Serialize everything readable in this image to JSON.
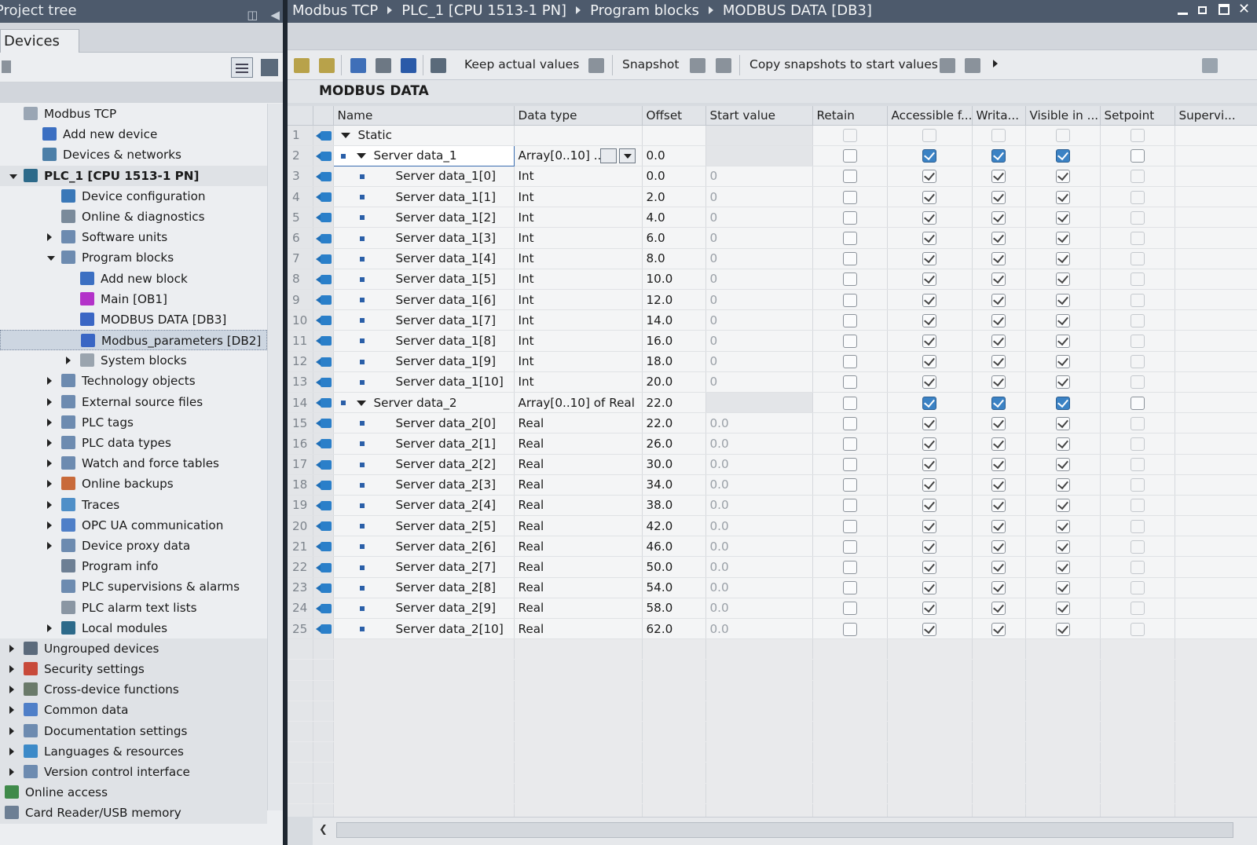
{
  "left_panel": {
    "title": "Project tree",
    "tab": "Devices"
  },
  "tree": [
    {
      "label": "Modbus TCP",
      "indent": 0,
      "arrow": "none",
      "icon": "project-icon",
      "color": "#9aa6b4"
    },
    {
      "label": "Add new device",
      "indent": 1,
      "arrow": "none",
      "icon": "add-device-icon",
      "color": "#3b6fc2"
    },
    {
      "label": "Devices & networks",
      "indent": 1,
      "arrow": "none",
      "icon": "network-icon",
      "color": "#4c7fa8"
    },
    {
      "label": "PLC_1 [CPU 1513-1 PN]",
      "indent": 0,
      "arrow": "d",
      "icon": "plc-icon",
      "color": "#2d6a8a",
      "bold": true,
      "dark": true
    },
    {
      "label": "Device configuration",
      "indent": 2,
      "arrow": "none",
      "icon": "device-config-icon",
      "color": "#3a78b8"
    },
    {
      "label": "Online & diagnostics",
      "indent": 2,
      "arrow": "none",
      "icon": "diagnostics-icon",
      "color": "#7a8a9a"
    },
    {
      "label": "Software units",
      "indent": 2,
      "arrow": "r",
      "icon": "folder-icon",
      "color": "#6d8bb0"
    },
    {
      "label": "Program blocks",
      "indent": 2,
      "arrow": "d",
      "icon": "folder-icon",
      "color": "#6d8bb0"
    },
    {
      "label": "Add new block",
      "indent": 3,
      "arrow": "none",
      "icon": "add-block-icon",
      "color": "#3b6fc2"
    },
    {
      "label": "Main [OB1]",
      "indent": 3,
      "arrow": "none",
      "icon": "ob-icon",
      "color": "#b332c9"
    },
    {
      "label": "MODBUS DATA [DB3]",
      "indent": 3,
      "arrow": "none",
      "icon": "db-icon",
      "color": "#3a66c4"
    },
    {
      "label": "Modbus_parameters [DB2]",
      "indent": 3,
      "arrow": "none",
      "icon": "db-icon",
      "color": "#3a66c4",
      "selected": true
    },
    {
      "label": "System blocks",
      "indent": 3,
      "arrow": "r",
      "icon": "folder-icon",
      "color": "#9aa4ae"
    },
    {
      "label": "Technology objects",
      "indent": 2,
      "arrow": "r",
      "icon": "folder-icon",
      "color": "#6d8bb0"
    },
    {
      "label": "External source files",
      "indent": 2,
      "arrow": "r",
      "icon": "folder-icon",
      "color": "#6d8bb0"
    },
    {
      "label": "PLC tags",
      "indent": 2,
      "arrow": "r",
      "icon": "folder-icon",
      "color": "#6d8bb0"
    },
    {
      "label": "PLC data types",
      "indent": 2,
      "arrow": "r",
      "icon": "folder-icon",
      "color": "#6d8bb0"
    },
    {
      "label": "Watch and force tables",
      "indent": 2,
      "arrow": "r",
      "icon": "folder-icon",
      "color": "#6d8bb0"
    },
    {
      "label": "Online backups",
      "indent": 2,
      "arrow": "r",
      "icon": "folder-icon",
      "color": "#c86a3a"
    },
    {
      "label": "Traces",
      "indent": 2,
      "arrow": "r",
      "icon": "folder-icon",
      "color": "#4f8fc8"
    },
    {
      "label": "OPC UA communication",
      "indent": 2,
      "arrow": "r",
      "icon": "opcua-icon",
      "color": "#4f7fc8"
    },
    {
      "label": "Device proxy data",
      "indent": 2,
      "arrow": "r",
      "icon": "folder-icon",
      "color": "#6d8bb0"
    },
    {
      "label": "Program info",
      "indent": 2,
      "arrow": "none",
      "icon": "program-info-icon",
      "color": "#6d7f94"
    },
    {
      "label": "PLC supervisions & alarms",
      "indent": 2,
      "arrow": "none",
      "icon": "alarms-icon",
      "color": "#6d8bb0"
    },
    {
      "label": "PLC alarm text lists",
      "indent": 2,
      "arrow": "none",
      "icon": "text-list-icon",
      "color": "#8a96a3"
    },
    {
      "label": "Local modules",
      "indent": 2,
      "arrow": "r",
      "icon": "folder-icon",
      "color": "#2d6a8a"
    },
    {
      "label": "Ungrouped devices",
      "indent": 0,
      "arrow": "r",
      "icon": "folder-icon",
      "color": "#5b6a7b",
      "dark": true
    },
    {
      "label": "Security settings",
      "indent": 0,
      "arrow": "r",
      "icon": "security-icon",
      "color": "#c84a3a",
      "dark": true
    },
    {
      "label": "Cross-device functions",
      "indent": 0,
      "arrow": "r",
      "icon": "cross-device-icon",
      "color": "#6a7a6a",
      "dark": true
    },
    {
      "label": "Common data",
      "indent": 0,
      "arrow": "r",
      "icon": "folder-icon",
      "color": "#4f7fc8",
      "dark": true
    },
    {
      "label": "Documentation settings",
      "indent": 0,
      "arrow": "r",
      "icon": "folder-icon",
      "color": "#6d8bb0",
      "dark": true
    },
    {
      "label": "Languages & resources",
      "indent": 0,
      "arrow": "r",
      "icon": "folder-icon",
      "color": "#3c8ac8",
      "dark": true
    },
    {
      "label": "Version control interface",
      "indent": 0,
      "arrow": "r",
      "icon": "folder-icon",
      "color": "#6d8bb0",
      "dark": true
    },
    {
      "label": "Online access",
      "indent": -1,
      "arrow": "none",
      "icon": "online-access-icon",
      "color": "#3f8a4a",
      "dark": true
    },
    {
      "label": "Card Reader/USB memory",
      "indent": -1,
      "arrow": "none",
      "icon": "card-reader-icon",
      "color": "#6d7f94",
      "dark": true
    }
  ],
  "breadcrumb": [
    "Modbus TCP",
    "PLC_1 [CPU 1513-1 PN]",
    "Program blocks",
    "MODBUS DATA [DB3]"
  ],
  "toolbar": {
    "keep_actual_values": "Keep actual values",
    "snapshot": "Snapshot",
    "copy_snapshots": "Copy snapshots to start values"
  },
  "db_title": "MODBUS DATA",
  "columns": [
    "",
    "",
    "Name",
    "Data type",
    "Offset",
    "Start value",
    "Retain",
    "Accessible f...",
    "Writa...",
    "Visible in ...",
    "Setpoint",
    "Supervi..."
  ],
  "rows": [
    {
      "num": "1",
      "name": "Static",
      "level": 0,
      "expand": true,
      "bullet": false,
      "type": "",
      "offset": "",
      "start": "",
      "retain": "dis",
      "access": "dis",
      "write": "dis",
      "visible": "dis",
      "setpoint": "dis"
    },
    {
      "num": "2",
      "name": "Server data_1",
      "level": 1,
      "expand": true,
      "bullet": true,
      "type": "Array[0..10] ...",
      "offset": "0.0",
      "start": "",
      "retain": "off",
      "access": "blue",
      "write": "blue",
      "visible": "blue",
      "setpoint": "off",
      "selected": true
    },
    {
      "num": "3",
      "name": "Server data_1[0]",
      "level": 2,
      "bullet": true,
      "type": "Int",
      "offset": "0.0",
      "start": "0",
      "retain": "off",
      "access": "on",
      "write": "on",
      "visible": "on",
      "setpoint": "dis"
    },
    {
      "num": "4",
      "name": "Server data_1[1]",
      "level": 2,
      "bullet": true,
      "type": "Int",
      "offset": "2.0",
      "start": "0",
      "retain": "off",
      "access": "on",
      "write": "on",
      "visible": "on",
      "setpoint": "dis"
    },
    {
      "num": "5",
      "name": "Server data_1[2]",
      "level": 2,
      "bullet": true,
      "type": "Int",
      "offset": "4.0",
      "start": "0",
      "retain": "off",
      "access": "on",
      "write": "on",
      "visible": "on",
      "setpoint": "dis"
    },
    {
      "num": "6",
      "name": "Server data_1[3]",
      "level": 2,
      "bullet": true,
      "type": "Int",
      "offset": "6.0",
      "start": "0",
      "retain": "off",
      "access": "on",
      "write": "on",
      "visible": "on",
      "setpoint": "dis"
    },
    {
      "num": "7",
      "name": "Server data_1[4]",
      "level": 2,
      "bullet": true,
      "type": "Int",
      "offset": "8.0",
      "start": "0",
      "retain": "off",
      "access": "on",
      "write": "on",
      "visible": "on",
      "setpoint": "dis"
    },
    {
      "num": "8",
      "name": "Server data_1[5]",
      "level": 2,
      "bullet": true,
      "type": "Int",
      "offset": "10.0",
      "start": "0",
      "retain": "off",
      "access": "on",
      "write": "on",
      "visible": "on",
      "setpoint": "dis"
    },
    {
      "num": "9",
      "name": "Server data_1[6]",
      "level": 2,
      "bullet": true,
      "type": "Int",
      "offset": "12.0",
      "start": "0",
      "retain": "off",
      "access": "on",
      "write": "on",
      "visible": "on",
      "setpoint": "dis"
    },
    {
      "num": "10",
      "name": "Server data_1[7]",
      "level": 2,
      "bullet": true,
      "type": "Int",
      "offset": "14.0",
      "start": "0",
      "retain": "off",
      "access": "on",
      "write": "on",
      "visible": "on",
      "setpoint": "dis"
    },
    {
      "num": "11",
      "name": "Server data_1[8]",
      "level": 2,
      "bullet": true,
      "type": "Int",
      "offset": "16.0",
      "start": "0",
      "retain": "off",
      "access": "on",
      "write": "on",
      "visible": "on",
      "setpoint": "dis"
    },
    {
      "num": "12",
      "name": "Server data_1[9]",
      "level": 2,
      "bullet": true,
      "type": "Int",
      "offset": "18.0",
      "start": "0",
      "retain": "off",
      "access": "on",
      "write": "on",
      "visible": "on",
      "setpoint": "dis"
    },
    {
      "num": "13",
      "name": "Server data_1[10]",
      "level": 2,
      "bullet": true,
      "type": "Int",
      "offset": "20.0",
      "start": "0",
      "retain": "off",
      "access": "on",
      "write": "on",
      "visible": "on",
      "setpoint": "dis"
    },
    {
      "num": "14",
      "name": "Server data_2",
      "level": 1,
      "expand": true,
      "bullet": true,
      "type": "Array[0..10] of Real",
      "offset": "22.0",
      "start": "",
      "retain": "off",
      "access": "blue",
      "write": "blue",
      "visible": "blue",
      "setpoint": "off"
    },
    {
      "num": "15",
      "name": "Server data_2[0]",
      "level": 2,
      "bullet": true,
      "type": "Real",
      "offset": "22.0",
      "start": "0.0",
      "retain": "off",
      "access": "on",
      "write": "on",
      "visible": "on",
      "setpoint": "dis"
    },
    {
      "num": "16",
      "name": "Server data_2[1]",
      "level": 2,
      "bullet": true,
      "type": "Real",
      "offset": "26.0",
      "start": "0.0",
      "retain": "off",
      "access": "on",
      "write": "on",
      "visible": "on",
      "setpoint": "dis"
    },
    {
      "num": "17",
      "name": "Server data_2[2]",
      "level": 2,
      "bullet": true,
      "type": "Real",
      "offset": "30.0",
      "start": "0.0",
      "retain": "off",
      "access": "on",
      "write": "on",
      "visible": "on",
      "setpoint": "dis"
    },
    {
      "num": "18",
      "name": "Server data_2[3]",
      "level": 2,
      "bullet": true,
      "type": "Real",
      "offset": "34.0",
      "start": "0.0",
      "retain": "off",
      "access": "on",
      "write": "on",
      "visible": "on",
      "setpoint": "dis"
    },
    {
      "num": "19",
      "name": "Server data_2[4]",
      "level": 2,
      "bullet": true,
      "type": "Real",
      "offset": "38.0",
      "start": "0.0",
      "retain": "off",
      "access": "on",
      "write": "on",
      "visible": "on",
      "setpoint": "dis"
    },
    {
      "num": "20",
      "name": "Server data_2[5]",
      "level": 2,
      "bullet": true,
      "type": "Real",
      "offset": "42.0",
      "start": "0.0",
      "retain": "off",
      "access": "on",
      "write": "on",
      "visible": "on",
      "setpoint": "dis"
    },
    {
      "num": "21",
      "name": "Server data_2[6]",
      "level": 2,
      "bullet": true,
      "type": "Real",
      "offset": "46.0",
      "start": "0.0",
      "retain": "off",
      "access": "on",
      "write": "on",
      "visible": "on",
      "setpoint": "dis"
    },
    {
      "num": "22",
      "name": "Server data_2[7]",
      "level": 2,
      "bullet": true,
      "type": "Real",
      "offset": "50.0",
      "start": "0.0",
      "retain": "off",
      "access": "on",
      "write": "on",
      "visible": "on",
      "setpoint": "dis"
    },
    {
      "num": "23",
      "name": "Server data_2[8]",
      "level": 2,
      "bullet": true,
      "type": "Real",
      "offset": "54.0",
      "start": "0.0",
      "retain": "off",
      "access": "on",
      "write": "on",
      "visible": "on",
      "setpoint": "dis"
    },
    {
      "num": "24",
      "name": "Server data_2[9]",
      "level": 2,
      "bullet": true,
      "type": "Real",
      "offset": "58.0",
      "start": "0.0",
      "retain": "off",
      "access": "on",
      "write": "on",
      "visible": "on",
      "setpoint": "dis"
    },
    {
      "num": "25",
      "name": "Server data_2[10]",
      "level": 2,
      "bullet": true,
      "type": "Real",
      "offset": "62.0",
      "start": "0.0",
      "retain": "off",
      "access": "on",
      "write": "on",
      "visible": "on",
      "setpoint": "dis"
    }
  ]
}
